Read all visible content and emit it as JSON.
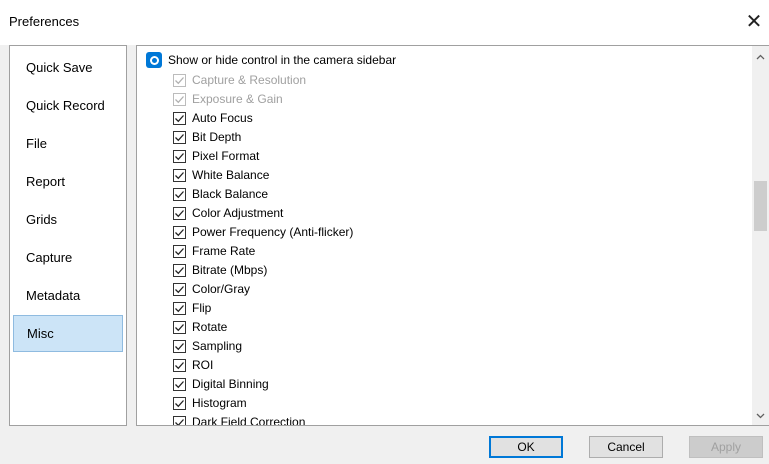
{
  "window": {
    "title": "Preferences"
  },
  "sidebar": {
    "items": [
      {
        "label": "Quick Save"
      },
      {
        "label": "Quick Record"
      },
      {
        "label": "File"
      },
      {
        "label": "Report"
      },
      {
        "label": "Grids"
      },
      {
        "label": "Capture"
      },
      {
        "label": "Metadata"
      },
      {
        "label": "Misc",
        "selected": true
      }
    ]
  },
  "content": {
    "radio_label": "Show or hide control in the camera sidebar",
    "options": [
      {
        "label": "Capture & Resolution",
        "checked": true,
        "enabled": false
      },
      {
        "label": "Exposure & Gain",
        "checked": true,
        "enabled": false
      },
      {
        "label": "Auto Focus",
        "checked": true,
        "enabled": true
      },
      {
        "label": "Bit Depth",
        "checked": true,
        "enabled": true
      },
      {
        "label": "Pixel Format",
        "checked": true,
        "enabled": true
      },
      {
        "label": "White Balance",
        "checked": true,
        "enabled": true
      },
      {
        "label": "Black Balance",
        "checked": true,
        "enabled": true
      },
      {
        "label": "Color Adjustment",
        "checked": true,
        "enabled": true
      },
      {
        "label": "Power Frequency (Anti-flicker)",
        "checked": true,
        "enabled": true
      },
      {
        "label": "Frame Rate",
        "checked": true,
        "enabled": true
      },
      {
        "label": "Bitrate (Mbps)",
        "checked": true,
        "enabled": true
      },
      {
        "label": "Color/Gray",
        "checked": true,
        "enabled": true
      },
      {
        "label": "Flip",
        "checked": true,
        "enabled": true
      },
      {
        "label": "Rotate",
        "checked": true,
        "enabled": true
      },
      {
        "label": "Sampling",
        "checked": true,
        "enabled": true
      },
      {
        "label": "ROI",
        "checked": true,
        "enabled": true
      },
      {
        "label": "Digital Binning",
        "checked": true,
        "enabled": true
      },
      {
        "label": "Histogram",
        "checked": true,
        "enabled": true
      },
      {
        "label": "Dark Field Correction",
        "checked": true,
        "enabled": true
      }
    ]
  },
  "buttons": {
    "ok": "OK",
    "cancel": "Cancel",
    "apply": "Apply"
  },
  "icons": {
    "close": "close-icon",
    "scroll_up": "chevron-up-icon",
    "scroll_down": "chevron-down-icon"
  },
  "colors": {
    "accent": "#0078d7",
    "selection": "#cce4f7"
  }
}
